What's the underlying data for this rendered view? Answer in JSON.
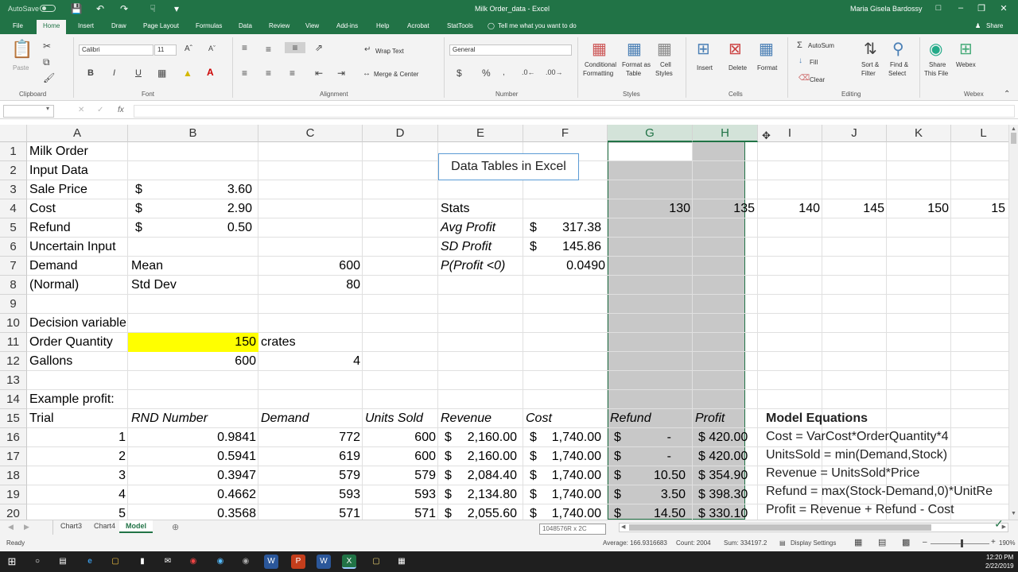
{
  "window": {
    "autosave": "AutoSave",
    "autosave_state": "Off",
    "title": "Milk Order_data  -  Excel",
    "user": "Maria Gisela Bardossy",
    "share": "Share"
  },
  "ribbon_tabs": [
    "File",
    "Home",
    "Insert",
    "Draw",
    "Page Layout",
    "Formulas",
    "Data",
    "Review",
    "View",
    "Add-ins",
    "Help",
    "Acrobat",
    "StatTools"
  ],
  "tell_me": "Tell me what you want to do",
  "ribbon": {
    "paste": "Paste",
    "clipboard": "Clipboard",
    "font_name": "Calibri",
    "font_size": "11",
    "font": "Font",
    "bold": "B",
    "italic": "I",
    "underline": "U",
    "wrap_text": "Wrap Text",
    "merge_center": "Merge & Center",
    "alignment": "Alignment",
    "number_format": "General",
    "number": "Number",
    "currency": "$",
    "percent": "%",
    "cond_fmt": [
      "Conditional",
      "Formatting"
    ],
    "fmt_table": [
      "Format as",
      "Table"
    ],
    "cell_styles": [
      "Cell",
      "Styles"
    ],
    "styles": "Styles",
    "insert": "Insert",
    "delete": "Delete",
    "format": "Format",
    "cells": "Cells",
    "autosum": "AutoSum",
    "fill": "Fill",
    "clear": "Clear",
    "sort_filter": [
      "Sort &",
      "Filter"
    ],
    "find_select": [
      "Find &",
      "Select"
    ],
    "editing": "Editing",
    "share_file": [
      "Share",
      "This File"
    ],
    "webex": "Webex"
  },
  "formula": {
    "fx": "fx"
  },
  "columns": [
    "A",
    "B",
    "C",
    "D",
    "E",
    "F",
    "G",
    "H",
    "I",
    "J",
    "K",
    "L"
  ],
  "rows": [
    "1",
    "2",
    "3",
    "4",
    "5",
    "6",
    "7",
    "8",
    "9",
    "10",
    "11",
    "12",
    "13",
    "14",
    "15",
    "16",
    "17",
    "18",
    "19",
    "20"
  ],
  "cells": {
    "a1": "Milk Order",
    "a2": "Input Data",
    "a3": "Sale Price",
    "b3s": "$",
    "b3": "3.60",
    "a4": "Cost",
    "b4s": "$",
    "b4": "2.90",
    "a5": "Refund",
    "b5s": "$",
    "b5": "0.50",
    "a6": "Uncertain Input",
    "a7": "Demand",
    "b7": "Mean",
    "c7": "600",
    "a8": "(Normal)",
    "b8": "Std Dev",
    "c8": "80",
    "a10": "Decision variable",
    "a11": "Order Quantity",
    "b11": "150",
    "c11": "crates",
    "a12": "Gallons",
    "b12": "600",
    "c12": "4",
    "a14": "Example profit:",
    "e4": "Stats",
    "e5": "Avg Profit",
    "f5s": "$",
    "f5": "317.38",
    "e6": "SD Profit",
    "f6s": "$",
    "f6": "145.86",
    "e7": "P(Profit <0)",
    "f7": "0.0490",
    "g4": "130",
    "h4": "135",
    "i4": "140",
    "j4": "145",
    "k4": "150",
    "l4": "15",
    "headers": [
      "Trial",
      "RND Number",
      "Demand",
      "Units Sold",
      "Revenue",
      "Cost",
      "Refund",
      "Profit"
    ]
  },
  "data_table_label": "Data Tables in Excel",
  "trials": [
    {
      "trial": "1",
      "rnd": "0.9841",
      "demand": "772",
      "units": "600",
      "revenue": "2,160.00",
      "cost": "1,740.00",
      "refund": "-",
      "profit": "$ 420.00"
    },
    {
      "trial": "2",
      "rnd": "0.5941",
      "demand": "619",
      "units": "600",
      "revenue": "2,160.00",
      "cost": "1,740.00",
      "refund": "-",
      "profit": "$ 420.00"
    },
    {
      "trial": "3",
      "rnd": "0.3947",
      "demand": "579",
      "units": "579",
      "revenue": "2,084.40",
      "cost": "1,740.00",
      "refund": "10.50",
      "profit": "$ 354.90"
    },
    {
      "trial": "4",
      "rnd": "0.4662",
      "demand": "593",
      "units": "593",
      "revenue": "2,134.80",
      "cost": "1,740.00",
      "refund": "3.50",
      "profit": "$ 398.30"
    },
    {
      "trial": "5",
      "rnd": "0.3568",
      "demand": "571",
      "units": "571",
      "revenue": "2,055.60",
      "cost": "1,740.00",
      "refund": "14.50",
      "profit": "$ 330.10"
    }
  ],
  "currency_symbol": "$",
  "model_equations": {
    "title": "Model Equations",
    "lines": [
      "Cost = VarCost*OrderQuantity*4",
      "UnitsSold = min(Demand,Stock)",
      "Revenue = UnitsSold*Price",
      "Refund = max(Stock-Demand,0)*UnitRe",
      "Profit = Revenue + Refund - Cost"
    ]
  },
  "sheets": [
    "Chart3",
    "Chart4",
    "Model"
  ],
  "tooltip": "1048576R x 2C",
  "status": {
    "ready": "Ready",
    "average": "Average: 166.9316683",
    "count": "Count: 2004",
    "sum": "Sum: 334197.2",
    "display": "Display Settings",
    "zoom": "190%"
  },
  "clock": {
    "time": "12:20 PM",
    "date": "2/22/2019"
  }
}
